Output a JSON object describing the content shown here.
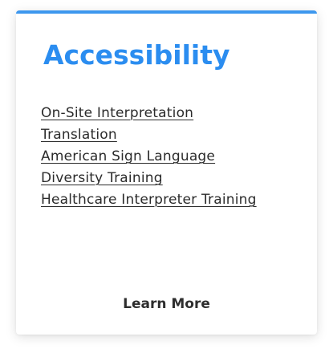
{
  "card": {
    "title": "Accessibility",
    "links": [
      "On-Site Interpretation",
      "Translation",
      "American Sign Language",
      "Diversity Training",
      "Healthcare Interpreter Training"
    ],
    "cta_label": "Learn More"
  },
  "colors": {
    "accent_bar": "#3d97ee",
    "title": "#2b8df0",
    "link_text": "#2b2b2b",
    "cta_text": "#2e2e2e"
  }
}
